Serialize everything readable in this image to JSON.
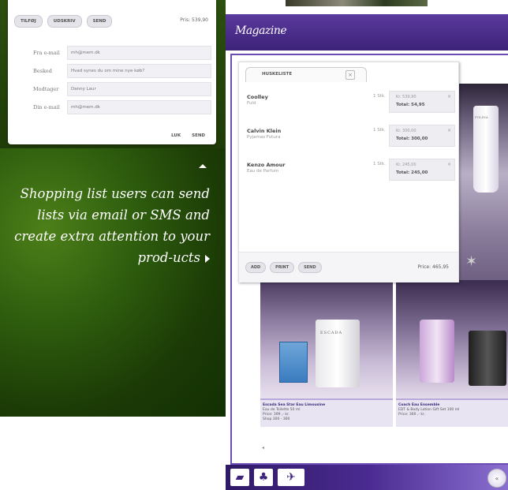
{
  "email_card": {
    "tabs": [
      "TILFØJ",
      "UDSKRIV",
      "SEND"
    ],
    "price": "Pris: 539,90",
    "fields": [
      {
        "label": "Fra e-mail",
        "value": "mh@mem.dk"
      },
      {
        "label": "Besked",
        "value": "Hvad synes du om mine nye køb?"
      },
      {
        "label": "Modtager",
        "value": "Danny Laur"
      },
      {
        "label": "Din e-mail",
        "value": "mh@mem.dk"
      }
    ],
    "actions": [
      "LUK",
      "SEND"
    ]
  },
  "promo": {
    "text": "Shopping list users can send lists via email or SMS and create extra attention to your prod-ucts"
  },
  "app": {
    "logo": "Magazine",
    "list_tab_label": "HUSKELISTE",
    "tab_close": "×",
    "items": [
      {
        "name": "Coolley",
        "sub": "Fuld",
        "qty": "1 Stk.",
        "unit": "Kr. 539,90",
        "total": "Total: 54,95"
      },
      {
        "name": "Calvin Klein",
        "sub": "Pyjamas Futura",
        "qty": "1 Stk.",
        "unit": "Kr. 300,00",
        "total": "Total: 300,00"
      },
      {
        "name": "Kenzo Amour",
        "sub": "Eau de Parfum",
        "qty": "1 Stk.",
        "unit": "Kr. 245,00",
        "total": "Total: 245,00"
      }
    ],
    "item_close": "×",
    "bottom_actions": [
      "ADD",
      "PRINT",
      "SEND"
    ],
    "bottom_price": "Price: 465,95",
    "tube_label": "FOLINA",
    "bottle_label": "ESCADA",
    "captions": [
      {
        "name": "Escada Sea Star Eau Limousine",
        "line1": "Eau de Toilette 50 ml",
        "line2": "Price: 399 ,- kr.",
        "line3": "Shop 300 - 300"
      },
      {
        "name": "Coach Eau Ensemble",
        "line1": "EDT & Body Lotion Gift Set 100 ml",
        "line2": "Price: 360 ,- kr.",
        "line3": ""
      }
    ],
    "back_arrow": "◂",
    "footer_circle": "«"
  }
}
